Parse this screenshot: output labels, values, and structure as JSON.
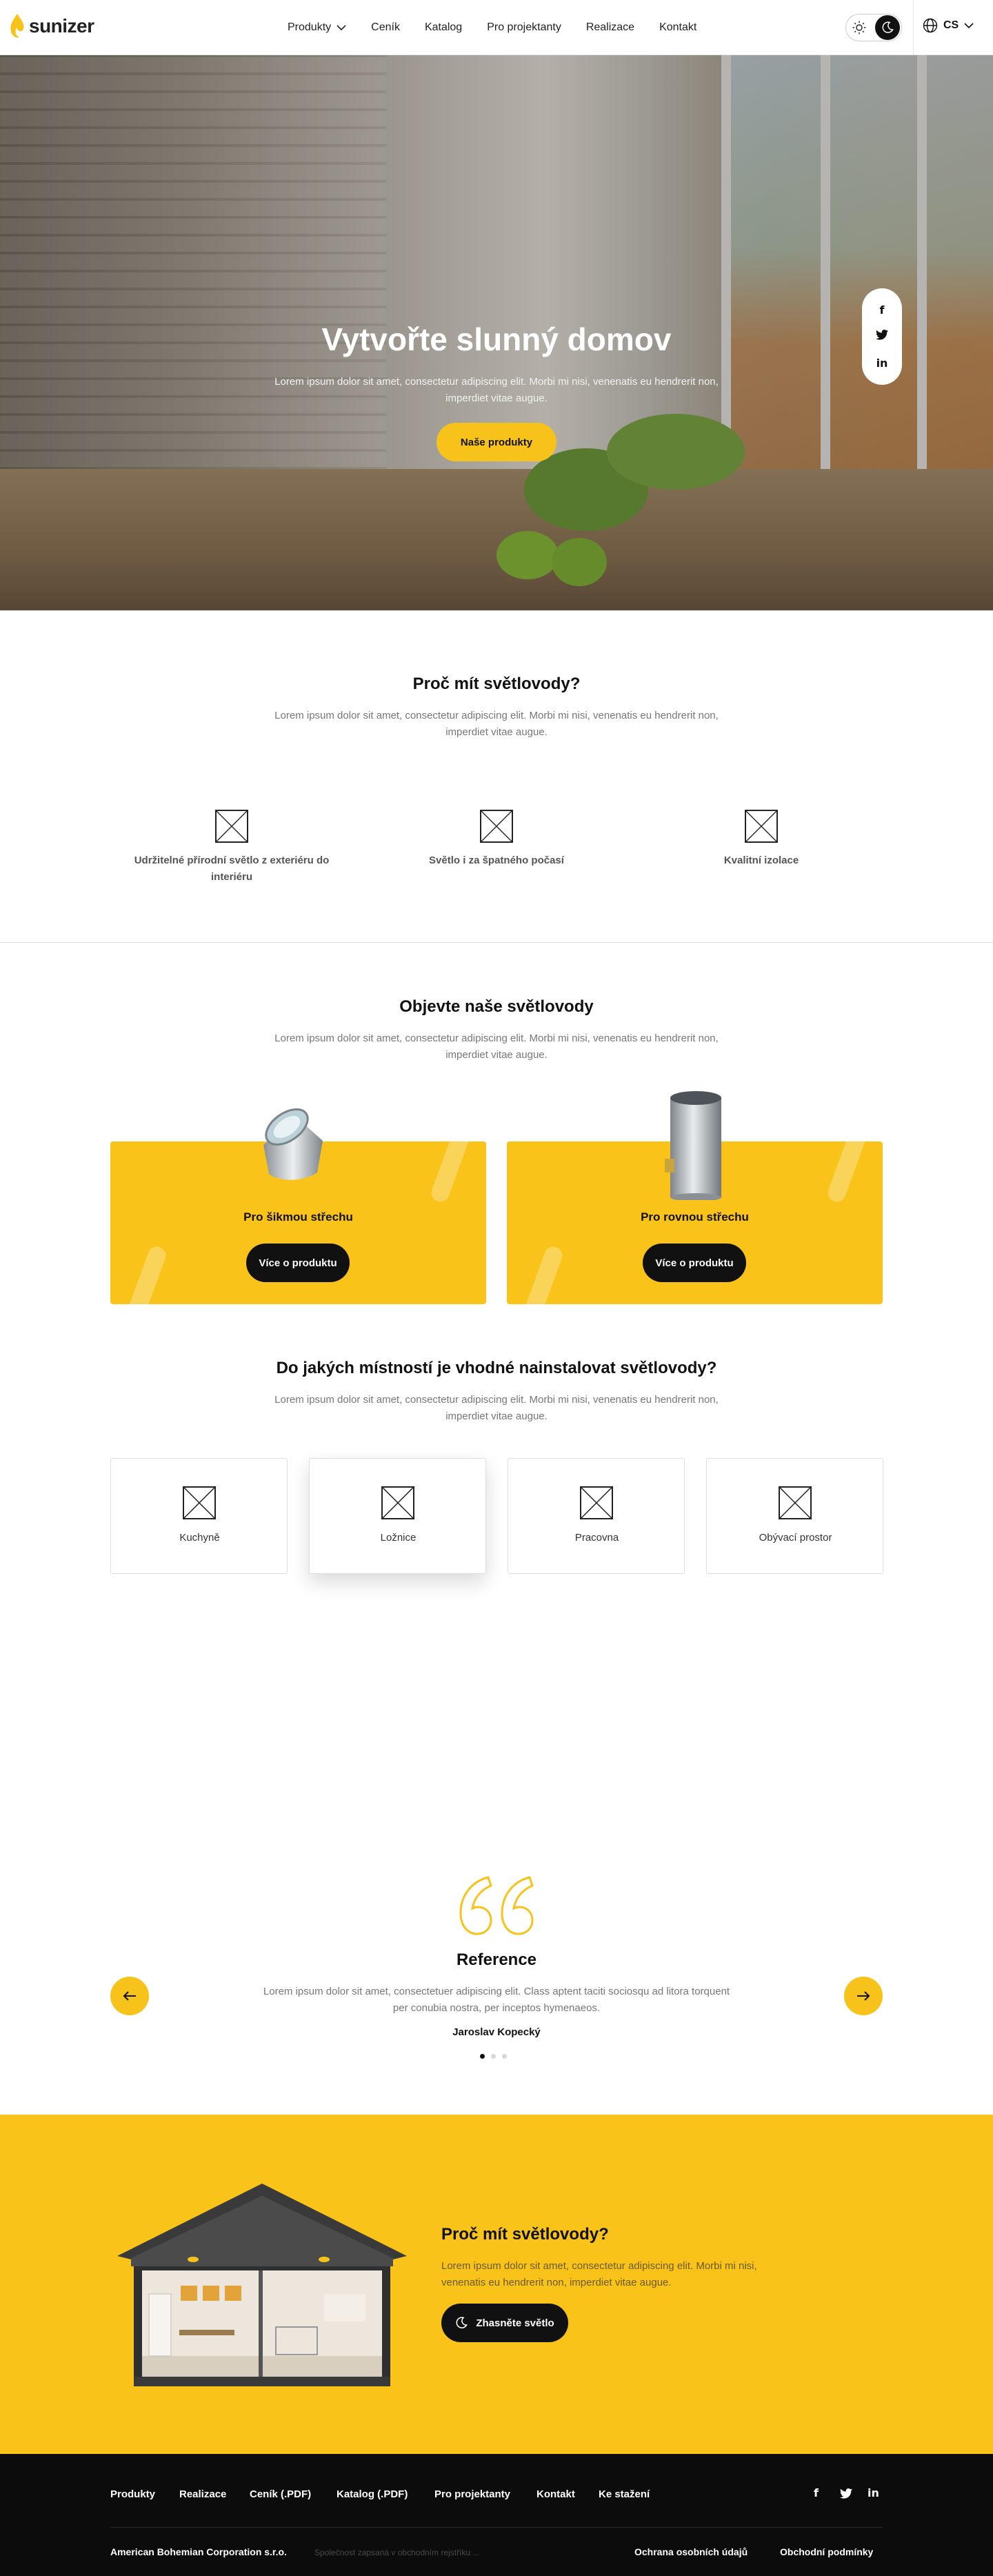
{
  "header": {
    "logo_text": "sunizer",
    "nav": [
      {
        "label": "Produkty",
        "has_dropdown": true
      },
      {
        "label": "Ceník"
      },
      {
        "label": "Katalog"
      },
      {
        "label": "Pro projektanty"
      },
      {
        "label": "Realizace"
      },
      {
        "label": "Kontakt"
      }
    ],
    "language": "CS"
  },
  "hero": {
    "title": "Vytvořte slunný domov",
    "text": "Lorem ipsum dolor sit amet, consectetur adipiscing elit. Morbi mi nisi, venenatis eu hendrerit non, imperdiet vitae augue.",
    "button": "Naše produkty",
    "social": [
      "f",
      "🐦",
      "in"
    ]
  },
  "why": {
    "title": "Proč mít světlovody?",
    "text": "Lorem ipsum dolor sit amet, consectetur adipiscing elit. Morbi mi nisi, venenatis eu hendrerit non, imperdiet vitae augue.",
    "features": [
      {
        "label": "Udržitelné přírodní světlo z exteriéru do interiéru"
      },
      {
        "label": "Světlo i za špatného počasí"
      },
      {
        "label": "Kvalitní izolace"
      }
    ]
  },
  "products": {
    "title": "Objevte naše světlovody",
    "text": "Lorem ipsum dolor sit amet, consectetur adipiscing elit. Morbi mi nisi, venenatis eu hendrerit non, imperdiet vitae augue.",
    "items": [
      {
        "title": "Pro šikmou střechu",
        "button": "Více o produktu"
      },
      {
        "title": "Pro rovnou střechu",
        "button": "Více o produktu"
      }
    ]
  },
  "rooms": {
    "title": "Do jakých místností je vhodné nainstalovat světlovody?",
    "text": "Lorem ipsum dolor sit amet, consectetur adipiscing elit. Morbi mi nisi, venenatis eu hendrerit non, imperdiet vitae augue.",
    "items": [
      {
        "label": "Kuchyně"
      },
      {
        "label": "Ložnice",
        "active": true
      },
      {
        "label": "Pracovna"
      },
      {
        "label": "Obývací prostor"
      }
    ]
  },
  "reference": {
    "title": "Reference",
    "text": "Lorem ipsum dolor sit amet, consectetuer adipiscing elit. Class aptent taciti sociosqu ad litora torquent per conubia nostra, per inceptos hymenaeos.",
    "author": "Jaroslav Kopecký",
    "active_slide": 1,
    "slides": 3
  },
  "cta": {
    "title": "Proč mít světlovody?",
    "text": "Lorem ipsum dolor sit amet, consectetur adipiscing elit. Morbi mi nisi, venenatis eu hendrerit non, imperdiet vitae augue.",
    "button": "Zhasněte světlo"
  },
  "footer": {
    "links": [
      "Produkty",
      "Realizace",
      "Ceník (.PDF)",
      "Katalog (.PDF)",
      "Pro projektanty",
      "Kontakt",
      "Ke stažení"
    ],
    "company": "American Bohemian Corporation s.r.o.",
    "company_note": "Společnost zapsaná v obchodním rejstříku ...",
    "privacy": "Ochrana osobních údajů",
    "terms": "Obchodní podmínky"
  },
  "colors": {
    "accent": "#F9C319",
    "dark": "#111111",
    "footer_bg": "#0C0C0C"
  }
}
